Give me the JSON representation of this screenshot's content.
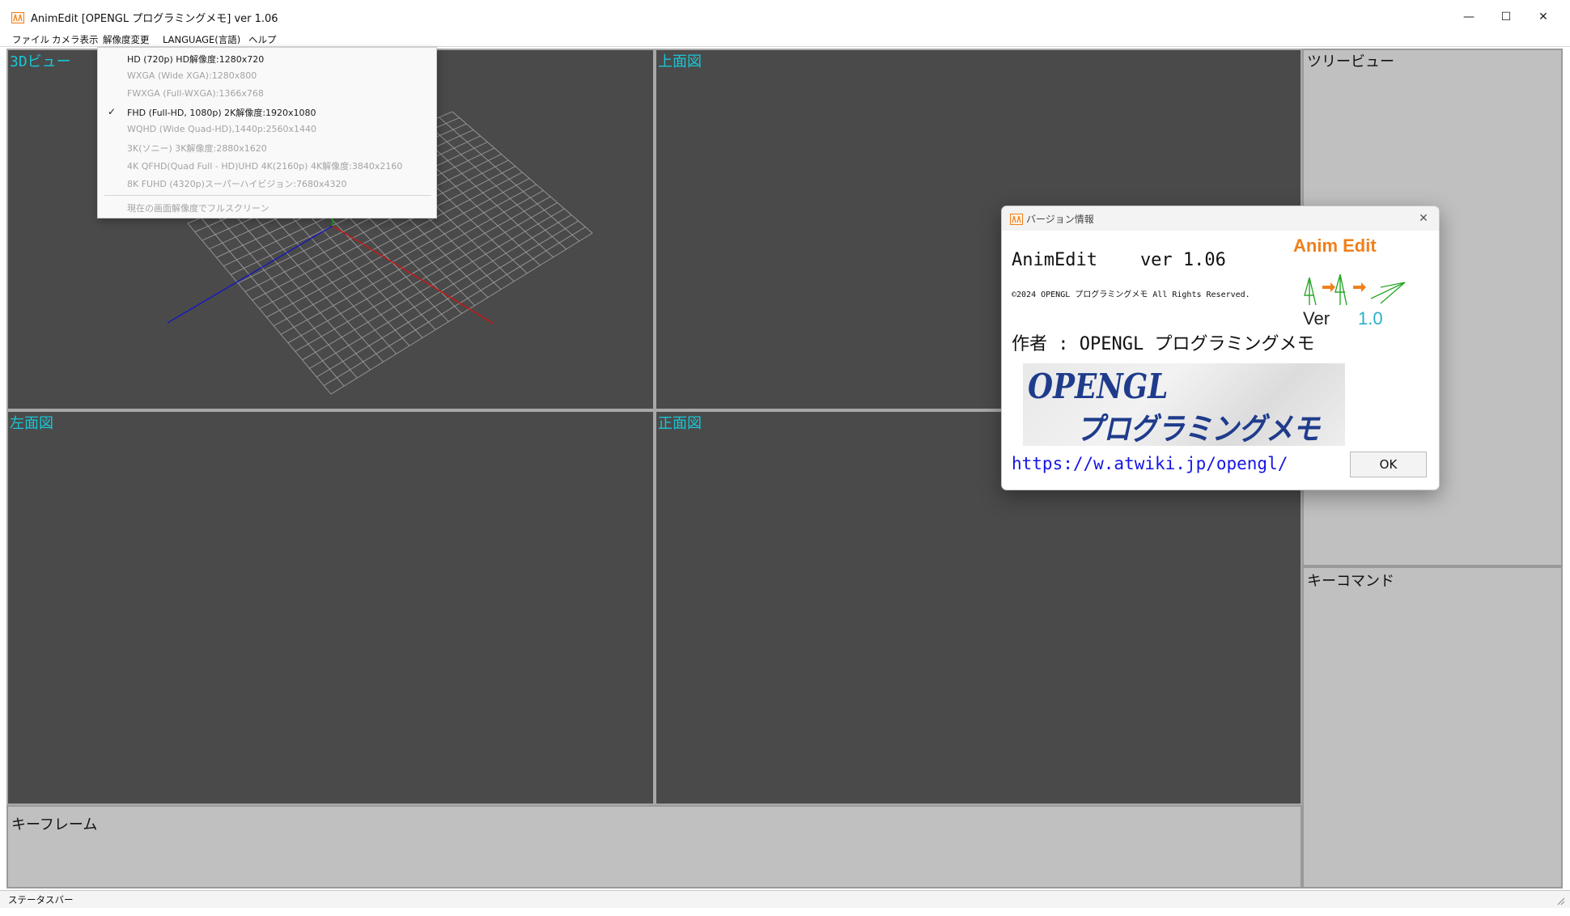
{
  "window": {
    "title": "AnimEdit [OPENGL プログラミングメモ] ver 1.06",
    "controls": {
      "minimize": "—",
      "maximize": "☐",
      "close": "✕"
    }
  },
  "menubar": {
    "items": [
      "ファイル",
      "カメラ表示",
      "解像度変更",
      "LANGUAGE(言語)",
      "ヘルプ"
    ]
  },
  "resolution_menu": {
    "options": [
      {
        "label": "HD (720p) HD解像度:1280x720",
        "enabled": true,
        "checked": false
      },
      {
        "label": "WXGA (Wide XGA):1280x800",
        "enabled": false,
        "checked": false
      },
      {
        "label": "FWXGA (Full-WXGA):1366x768",
        "enabled": false,
        "checked": false
      },
      {
        "label": "FHD (Full-HD, 1080p) 2K解像度:1920x1080",
        "enabled": true,
        "checked": true
      },
      {
        "label": "WQHD (Wide Quad-HD),1440p:2560x1440",
        "enabled": false,
        "checked": false
      },
      {
        "label": "3K(ソニー) 3K解像度:2880x1620",
        "enabled": false,
        "checked": false
      },
      {
        "label": "4K QFHD(Quad Full - HD)UHD 4K(2160p) 4K解像度:3840x2160",
        "enabled": false,
        "checked": false
      },
      {
        "label": "8K FUHD (4320p)スーパーハイビジョン:7680x4320",
        "enabled": false,
        "checked": false
      }
    ],
    "check_mark": "✓",
    "fullscreen_label": "現在の画面解像度でフルスクリーン"
  },
  "viewports": {
    "view3d": "3Dビュー",
    "top": "上面図",
    "left": "左面図",
    "front": "正面図"
  },
  "panels": {
    "tree_view": "ツリービュー",
    "key_command": "キーコマンド",
    "keyframe": "キーフレーム"
  },
  "statusbar": {
    "text": "ステータスバー"
  },
  "about_dialog": {
    "title": "バージョン情報",
    "close_glyph": "✕",
    "app_name_line": "AnimEdit    ver 1.06",
    "copyright": "©2024 OPENGL プログラミングメモ All Rights Reserved.",
    "author_line": "作者 : OPENGL プログラミングメモ",
    "logo_text": "Anim Edit",
    "logo_ver_label": "Ver",
    "logo_ver_number": "1.0",
    "banner_line1": "OPENGL",
    "banner_line2": "プログラミングメモ",
    "url": "https://w.atwiki.jp/opengl/",
    "ok_label": "OK"
  },
  "colors": {
    "viewport_bg": "#4a4a4a",
    "viewport_label": "#18c6d6",
    "panel_bg": "#c0c0c0",
    "axis_x": "#c41a1a",
    "axis_z": "#1a1ab8",
    "axis_y": "#1aa81a",
    "logo_orange": "#f0801c",
    "link_blue": "#1515e6"
  }
}
